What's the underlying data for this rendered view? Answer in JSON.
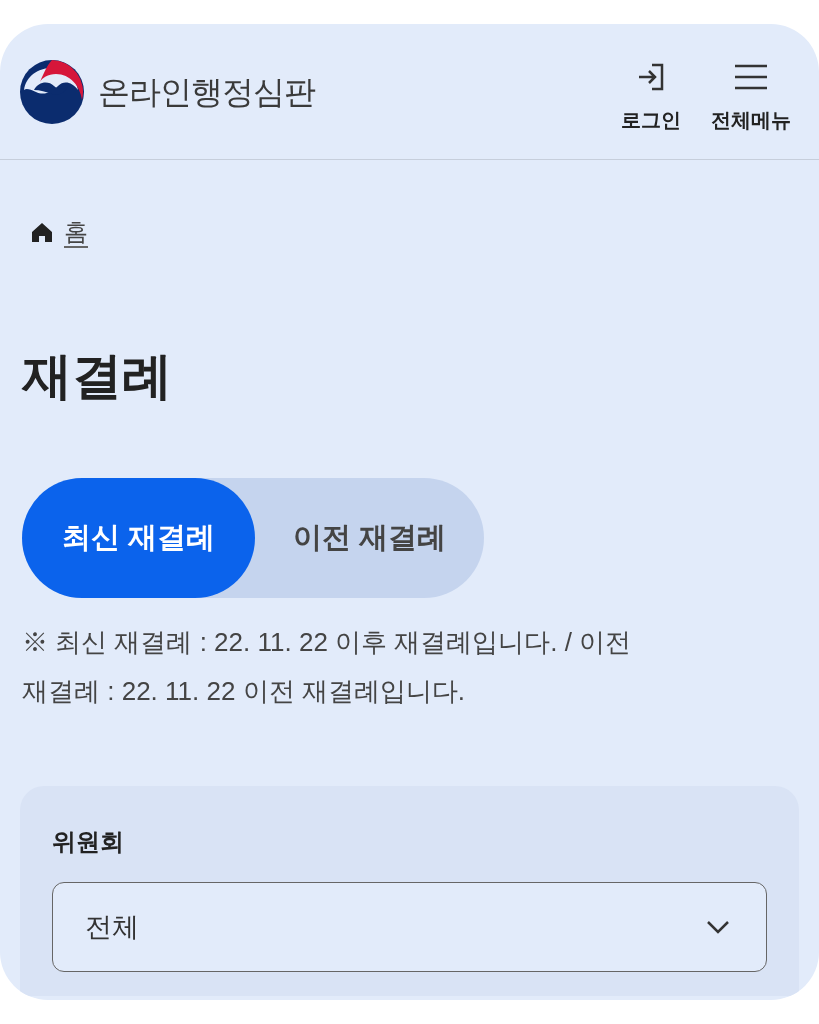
{
  "header": {
    "site_title": "온라인행정심판",
    "actions": [
      {
        "label": "로그인",
        "kind": "login"
      },
      {
        "label": "전체메뉴",
        "kind": "menu"
      }
    ]
  },
  "breadcrumb": [
    {
      "label": "홈",
      "kind": "home"
    }
  ],
  "page_title": "재결례",
  "tabs": [
    {
      "label": "최신 재결례",
      "selected": true
    },
    {
      "label": "이전 재결례",
      "selected": false
    }
  ],
  "notice": "※ 최신 재결례 : 22. 11. 22 이후 재결례입니다. / 이전 재결례 : 22. 11. 22 이전 재결례입니다.",
  "filter": {
    "label": "위원회",
    "value": "전체"
  }
}
